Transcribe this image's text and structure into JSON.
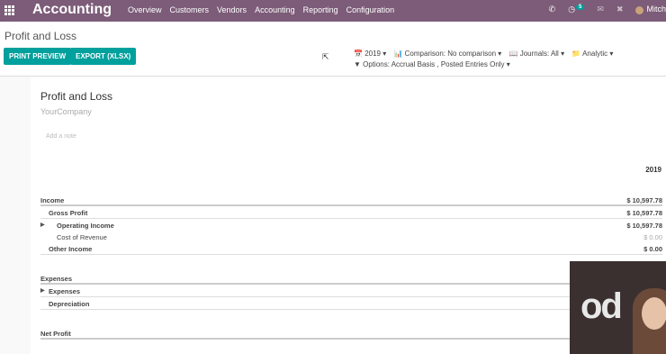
{
  "navbar": {
    "brand": "Accounting",
    "menu": [
      "Overview",
      "Customers",
      "Vendors",
      "Accounting",
      "Reporting",
      "Configuration"
    ],
    "phone_icon": "phone-icon",
    "activity_count": "5",
    "user_name": "Mitch"
  },
  "control_panel": {
    "breadcrumb": "Profit and Loss",
    "print_preview_label": "PRINT PREVIEW",
    "export_label": "EXPORT (XLSX)",
    "filter_year": "2019",
    "filter_comparison": "Comparison: No comparison",
    "filter_journals": "Journals: All",
    "filter_analytic": "Analytic",
    "filter_options": "Options: Accrual Basis , Posted Entries Only"
  },
  "report": {
    "title": "Profit and Loss",
    "company": "YourCompany",
    "note_placeholder": "Add a note",
    "column_header": "2019",
    "rows": [
      {
        "label": "Income",
        "amount": "$ 10,597.78"
      },
      {
        "label": "Gross Profit",
        "amount": "$ 10,597.78"
      },
      {
        "label": "Operating Income",
        "amount": "$ 10,597.78"
      },
      {
        "label": "Cost of Revenue",
        "amount": "$ 0.00"
      },
      {
        "label": "Other Income",
        "amount": "$ 0.00"
      },
      {
        "label": "Expenses",
        "amount": ""
      },
      {
        "label": "Expenses",
        "amount": ""
      },
      {
        "label": "Depreciation",
        "amount": ""
      },
      {
        "label": "Net Profit",
        "amount": ""
      }
    ]
  },
  "video_overlay": {
    "logo_text": "od"
  },
  "colors": {
    "navbar": "#7c5c78",
    "primary_button": "#00a09d"
  }
}
